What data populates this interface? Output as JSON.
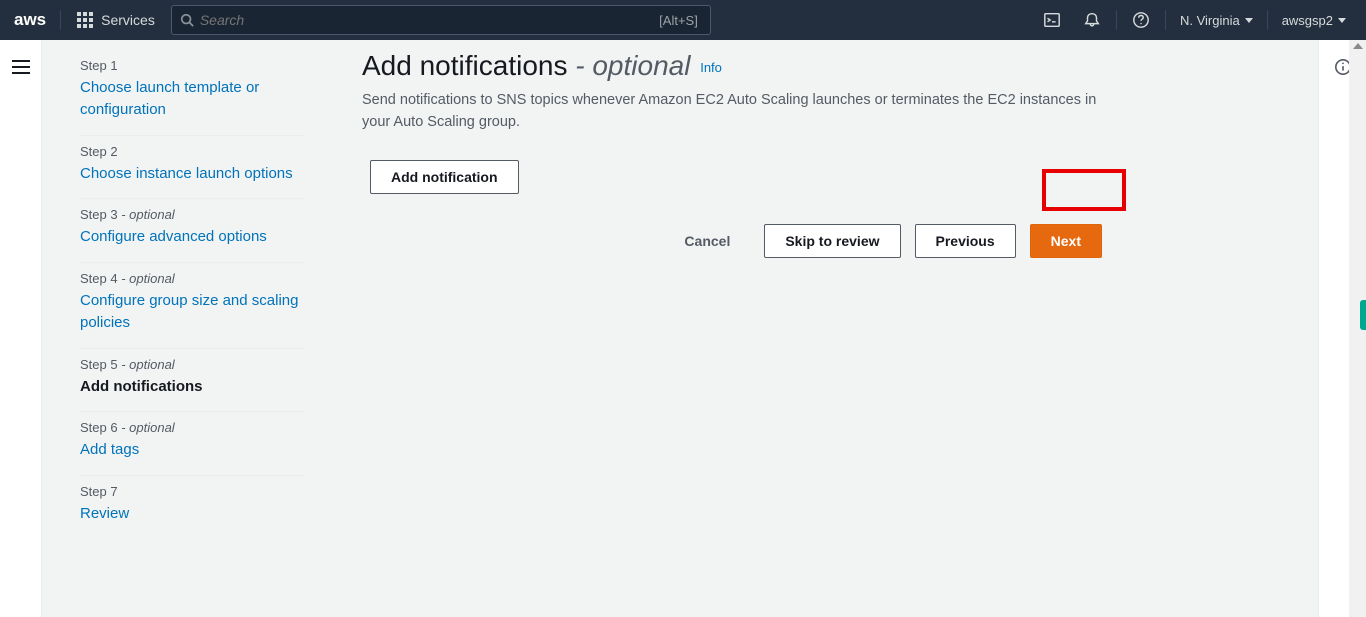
{
  "topnav": {
    "logo_text": "aws",
    "services_label": "Services",
    "search_placeholder": "Search",
    "search_shortcut": "[Alt+S]",
    "region": "N. Virginia",
    "user": "awsgsp2"
  },
  "sidebar": {
    "steps": [
      {
        "num": "Step 1",
        "opt": "",
        "label": "Choose launch template or configuration",
        "active": false
      },
      {
        "num": "Step 2",
        "opt": "",
        "label": "Choose instance launch options",
        "active": false
      },
      {
        "num": "Step 3",
        "opt": " - optional",
        "label": "Configure advanced options",
        "active": false
      },
      {
        "num": "Step 4",
        "opt": " - optional",
        "label": "Configure group size and scaling policies",
        "active": false
      },
      {
        "num": "Step 5",
        "opt": " - optional",
        "label": "Add notifications",
        "active": true
      },
      {
        "num": "Step 6",
        "opt": " - optional",
        "label": "Add tags",
        "active": false
      },
      {
        "num": "Step 7",
        "opt": "",
        "label": "Review",
        "active": false
      }
    ]
  },
  "main": {
    "title_main": "Add notifications ",
    "title_opt": "- optional",
    "info_label": "Info",
    "description": "Send notifications to SNS topics whenever Amazon EC2 Auto Scaling launches or terminates the EC2 instances in your Auto Scaling group.",
    "add_notification_btn": "Add notification",
    "footer": {
      "cancel": "Cancel",
      "skip": "Skip to review",
      "previous": "Previous",
      "next": "Next"
    }
  }
}
